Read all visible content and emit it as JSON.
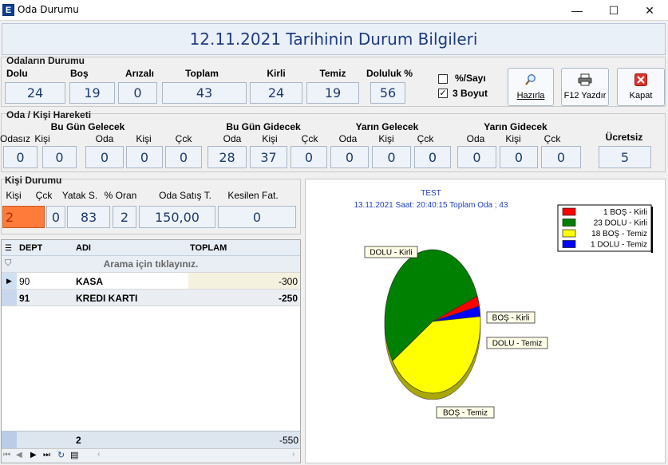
{
  "window": {
    "title": "Oda Durumu",
    "app_icon": "E",
    "minimize": "—",
    "maximize": "☐",
    "close": "✕"
  },
  "header": {
    "title": "12.11.2021 Tarihinin Durum Bilgileri"
  },
  "oda_durumu": {
    "title": "Odaların Durumu",
    "labels": {
      "dolu": "Dolu",
      "bos": "Boş",
      "arizali": "Arızalı",
      "toplam": "Toplam",
      "kirli": "Kirli",
      "temiz": "Temiz",
      "doluluk": "Doluluk %"
    },
    "values": {
      "dolu": "24",
      "bos": "19",
      "arizali": "0",
      "toplam": "43",
      "kirli": "24",
      "temiz": "19",
      "doluluk": "56"
    },
    "options": {
      "yuzde_sayi": "%/Sayı",
      "uc_boyut": "3 Boyut",
      "uc_boyut_checked": "✓"
    }
  },
  "buttons": {
    "hazirla": "Hazırla",
    "yazdir": "F12 Yazdır",
    "kapat": "Kapat"
  },
  "kisi_hareketi": {
    "title": "Oda / Kişi Hareketi",
    "groups": {
      "bugun_gelecek": "Bu Gün Gelecek",
      "bugun_gidecek": "Bu Gün Gidecek",
      "yarin_gelecek": "Yarın Gelecek",
      "yarin_gidecek": "Yarın Gidecek",
      "ucretsiz": "Ücretsiz"
    },
    "cols": {
      "odasiz": "Odasız",
      "kisi": "Kişi",
      "oda": "Oda",
      "cck": "Çck"
    },
    "values": {
      "odasiz": "0",
      "odasiz_kisi": "0",
      "bgel_oda": "0",
      "bgel_kisi": "0",
      "bgel_cck": "0",
      "bgid_oda": "28",
      "bgid_kisi": "37",
      "bgid_cck": "0",
      "ygel_oda": "0",
      "ygel_kisi": "0",
      "ygel_cck": "0",
      "ygid_oda": "0",
      "ygid_kisi": "0",
      "ygid_cck": "0",
      "ucretsiz": "5"
    }
  },
  "kisi_durumu": {
    "title": "Kişi Durumu",
    "labels": {
      "kisi": "Kişi",
      "cck": "Çck",
      "yatak": "Yatak S.",
      "oran": "% Oran",
      "satis": "Oda Satış T.",
      "kesilen": "Kesilen Fat."
    },
    "values": {
      "kisi": "2",
      "cck": "0",
      "yatak": "83",
      "oran": "2",
      "satis": "150,00",
      "kesilen": "0"
    }
  },
  "grid": {
    "columns": [
      "DEPT",
      "ADI",
      "TOPLAM"
    ],
    "filter_text": "Arama için tıklayınız.",
    "rows": [
      {
        "dept": "90",
        "adi": "KASA",
        "toplam": "-300"
      },
      {
        "dept": "91",
        "adi": "KREDI KARTI",
        "toplam": "-250"
      }
    ],
    "footer": {
      "count": "2",
      "total": "-550"
    }
  },
  "chart_data": {
    "type": "pie",
    "title": "TEST",
    "subtitle": "13.11.2021 Saat: 20:40:15 Toplam Oda ; 43",
    "slices": [
      {
        "label": "BOŞ - Kirli",
        "value": 1,
        "color": "#ff0000"
      },
      {
        "label": "DOLU - Kirli",
        "value": 23,
        "color": "#008000"
      },
      {
        "label": "BOŞ - Temiz",
        "value": 18,
        "color": "#ffff00"
      },
      {
        "label": "DOLU - Temiz",
        "value": 1,
        "color": "#0000ff"
      }
    ],
    "legend": [
      "1 BOŞ - Kirli",
      "23 DOLU - Kirli",
      "18 BOŞ - Temiz",
      "1 DOLU - Temiz"
    ],
    "legend_placement": "top-right",
    "three_d": true
  }
}
